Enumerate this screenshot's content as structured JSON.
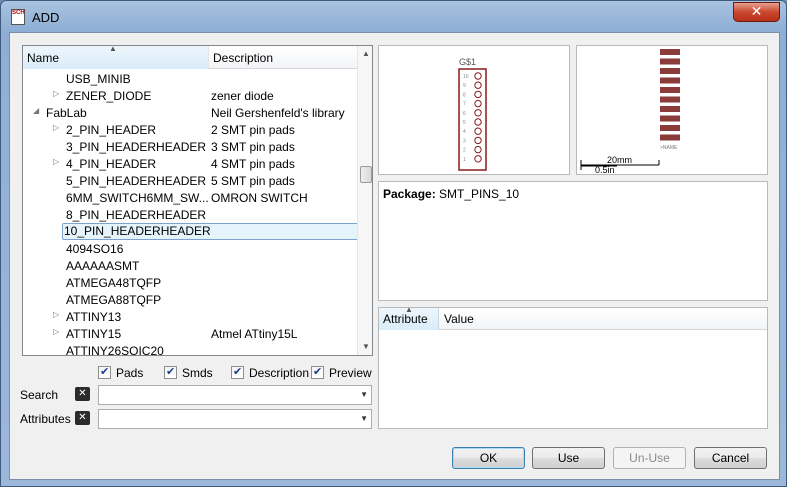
{
  "window": {
    "title": "ADD",
    "close_glyph": "✕",
    "app_icon_text": "SCH"
  },
  "tree": {
    "columns": {
      "name": "Name",
      "description": "Description"
    },
    "rows": [
      {
        "indent": 2,
        "expander": "",
        "name": "USB_MINIB",
        "desc": ""
      },
      {
        "indent": 2,
        "expander": "▷",
        "name": "ZENER_DIODE",
        "desc": "zener diode"
      },
      {
        "indent": 1,
        "expander": "◢",
        "name": "FabLab",
        "desc": "Neil Gershenfeld's library"
      },
      {
        "indent": 2,
        "expander": "▷",
        "name": "2_PIN_HEADER",
        "desc": "2 SMT pin pads"
      },
      {
        "indent": 2,
        "expander": "",
        "name": "3_PIN_HEADERHEADER",
        "desc": "3 SMT pin pads"
      },
      {
        "indent": 2,
        "expander": "▷",
        "name": "4_PIN_HEADER",
        "desc": "4 SMT pin pads"
      },
      {
        "indent": 2,
        "expander": "",
        "name": "5_PIN_HEADERHEADER",
        "desc": "5 SMT pin pads"
      },
      {
        "indent": 2,
        "expander": "",
        "name": "6MM_SWITCH6MM_SW...",
        "desc": "OMRON SWITCH"
      },
      {
        "indent": 2,
        "expander": "",
        "name": "8_PIN_HEADERHEADER",
        "desc": ""
      },
      {
        "indent": 2,
        "expander": "",
        "name": "10_PIN_HEADERHEADER",
        "desc": "",
        "selected": true
      },
      {
        "indent": 2,
        "expander": "",
        "name": "4094SO16",
        "desc": ""
      },
      {
        "indent": 2,
        "expander": "",
        "name": "AAAAAASMT",
        "desc": ""
      },
      {
        "indent": 2,
        "expander": "",
        "name": "ATMEGA48TQFP",
        "desc": ""
      },
      {
        "indent": 2,
        "expander": "",
        "name": "ATMEGA88TQFP",
        "desc": ""
      },
      {
        "indent": 2,
        "expander": "▷",
        "name": "ATTINY13",
        "desc": ""
      },
      {
        "indent": 2,
        "expander": "▷",
        "name": "ATTINY15",
        "desc": "Atmel ATtiny15L"
      },
      {
        "indent": 2,
        "expander": "",
        "name": "ATTINY26SOIC20",
        "desc": ""
      }
    ]
  },
  "filters": {
    "pads": "Pads",
    "smds": "Smds",
    "description": "Description",
    "preview": "Preview"
  },
  "search": {
    "label": "Search",
    "value": ""
  },
  "attributes_field": {
    "label": "Attributes",
    "value": ""
  },
  "symbol_preview": {
    "gate_name": "G$1",
    "pin_count": 10
  },
  "package_preview": {
    "scale_mm": "20mm",
    "scale_in": "0.5in",
    "name_label": ">NAME"
  },
  "package_info": {
    "label": "Package:",
    "value": "SMT_PINS_10"
  },
  "attribute_table": {
    "col_attribute": "Attribute",
    "col_value": "Value"
  },
  "buttons": {
    "ok": "OK",
    "use": "Use",
    "unuse": "Un-Use",
    "cancel": "Cancel"
  }
}
